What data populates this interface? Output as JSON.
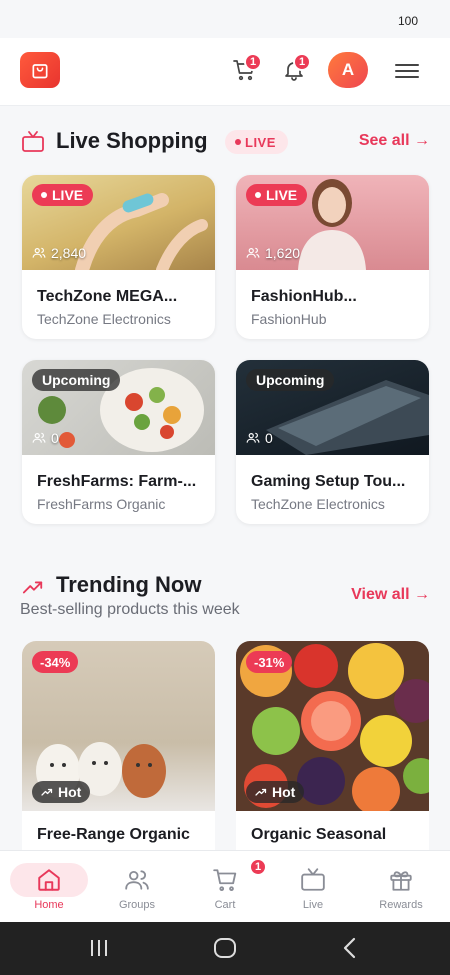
{
  "status": {
    "battery": "100"
  },
  "header": {
    "cart_badge": "1",
    "notif_badge": "1",
    "avatar_initial": "A"
  },
  "live": {
    "title": "Live Shopping",
    "pill": "LIVE",
    "see_all": "See all →",
    "cards": [
      {
        "tag": "LIVE",
        "viewers": "2,840",
        "title": "TechZone MEGA...",
        "seller": "TechZone Electronics"
      },
      {
        "tag": "LIVE",
        "viewers": "1,620",
        "title": "FashionHub...",
        "seller": "FashionHub"
      },
      {
        "tag": "Upcoming",
        "viewers": "0",
        "title": "FreshFarms: Farm-...",
        "seller": "FreshFarms Organic"
      },
      {
        "tag": "Upcoming",
        "viewers": "0",
        "title": "Gaming Setup Tou...",
        "seller": "TechZone Electronics"
      }
    ]
  },
  "trending": {
    "title": "Trending Now",
    "subtitle": "Best-selling products this week",
    "view_all": "View all →",
    "products": [
      {
        "discount": "-34%",
        "hot": "Hot",
        "title": "Free-Range Organic"
      },
      {
        "discount": "-31%",
        "hot": "Hot",
        "title": "Organic Seasonal"
      }
    ]
  },
  "nav": {
    "items": [
      {
        "label": "Home",
        "icon": "home-icon"
      },
      {
        "label": "Groups",
        "icon": "users-icon"
      },
      {
        "label": "Cart",
        "icon": "cart-icon",
        "badge": "1"
      },
      {
        "label": "Live",
        "icon": "tv-icon"
      },
      {
        "label": "Rewards",
        "icon": "gift-icon"
      }
    ]
  },
  "colors": {
    "accent": "#e8385a",
    "badge": "#ec3b55",
    "logo": "#ff5a3c"
  }
}
